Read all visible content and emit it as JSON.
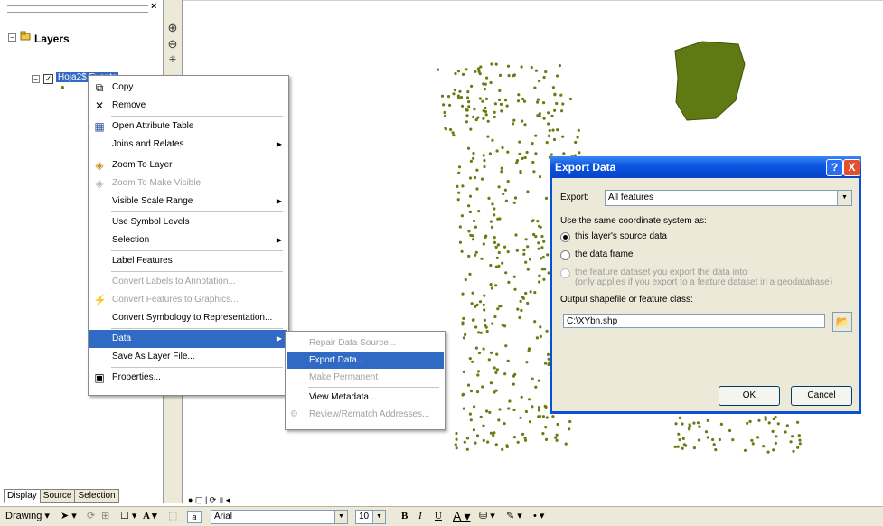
{
  "toc": {
    "root_label": "Layers",
    "layer_name": "Hoja2$ Events",
    "tabs": [
      "Display",
      "Source",
      "Selection"
    ]
  },
  "context_menu": {
    "items": [
      {
        "label": "Copy",
        "icon": "copy-icon",
        "disabled": false
      },
      {
        "label": "Remove",
        "icon": "remove-icon",
        "disabled": false
      },
      {
        "label": "Open Attribute Table",
        "icon": "table-icon",
        "disabled": false
      },
      {
        "label": "Joins and Relates",
        "icon": "",
        "disabled": false,
        "submenu": true
      },
      {
        "label": "Zoom To Layer",
        "icon": "zoom-to-layer-icon",
        "disabled": false
      },
      {
        "label": "Zoom To Make Visible",
        "icon": "zoom-make-visible-icon",
        "disabled": true
      },
      {
        "label": "Visible Scale Range",
        "icon": "",
        "disabled": false,
        "submenu": true
      },
      {
        "label": "Use Symbol Levels",
        "icon": "",
        "disabled": false
      },
      {
        "label": "Selection",
        "icon": "",
        "disabled": false,
        "submenu": true
      },
      {
        "label": "Label Features",
        "icon": "",
        "disabled": false
      },
      {
        "label": "Convert Labels to Annotation...",
        "icon": "",
        "disabled": true
      },
      {
        "label": "Convert Features to Graphics...",
        "icon": "convert-graphics-icon",
        "disabled": true
      },
      {
        "label": "Convert Symbology to Representation...",
        "icon": "",
        "disabled": false
      },
      {
        "label": "Data",
        "icon": "",
        "disabled": false,
        "submenu": true,
        "highlighted": true
      },
      {
        "label": "Save As Layer File...",
        "icon": "",
        "disabled": false
      },
      {
        "label": "Properties...",
        "icon": "properties-icon",
        "disabled": false
      }
    ]
  },
  "data_submenu": {
    "items": [
      {
        "label": "Repair Data Source...",
        "disabled": true
      },
      {
        "label": "Export Data...",
        "disabled": false,
        "highlighted": true
      },
      {
        "label": "Make Permanent",
        "disabled": true
      },
      {
        "label": "View Metadata...",
        "disabled": false
      },
      {
        "label": "Review/Rematch Addresses...",
        "disabled": true
      }
    ]
  },
  "export_dialog": {
    "title": "Export Data",
    "export_label": "Export:",
    "export_value": "All features",
    "coord_prompt": "Use the same coordinate system as:",
    "option_source": "this layer's source data",
    "option_frame": "the data frame",
    "option_dataset_line1": "the feature dataset you export the data into",
    "option_dataset_line2": "(only applies if you export to a feature dataset in a geodatabase)",
    "output_label": "Output shapefile or feature class:",
    "output_value": "C:\\XYbn.shp",
    "ok_label": "OK",
    "cancel_label": "Cancel",
    "help_btn": "?",
    "close_btn": "X"
  },
  "drawing_toolbar": {
    "drawing_label": "Drawing",
    "font_name": "Arial",
    "font_size": "10",
    "bold": "B",
    "italic": "I",
    "underline": "U",
    "text_tool": "A"
  },
  "colors": {
    "selection_blue": "#316ac5",
    "title_blue": "#0a55e0",
    "point_olive": "#6b7a12",
    "dialog_face": "#ece9d8"
  }
}
